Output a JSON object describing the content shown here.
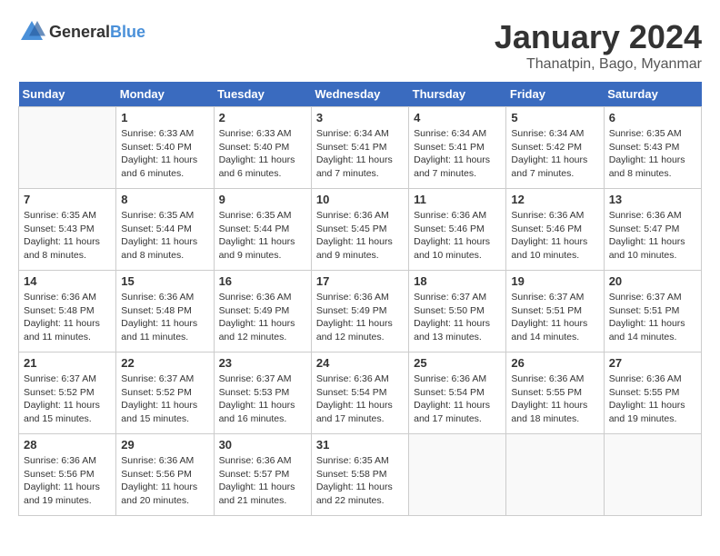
{
  "header": {
    "logo_general": "General",
    "logo_blue": "Blue",
    "month_title": "January 2024",
    "location": "Thanatpin, Bago, Myanmar"
  },
  "weekdays": [
    "Sunday",
    "Monday",
    "Tuesday",
    "Wednesday",
    "Thursday",
    "Friday",
    "Saturday"
  ],
  "weeks": [
    [
      {
        "day": "",
        "sunrise": "",
        "sunset": "",
        "daylight": ""
      },
      {
        "day": "1",
        "sunrise": "Sunrise: 6:33 AM",
        "sunset": "Sunset: 5:40 PM",
        "daylight": "Daylight: 11 hours and 6 minutes."
      },
      {
        "day": "2",
        "sunrise": "Sunrise: 6:33 AM",
        "sunset": "Sunset: 5:40 PM",
        "daylight": "Daylight: 11 hours and 6 minutes."
      },
      {
        "day": "3",
        "sunrise": "Sunrise: 6:34 AM",
        "sunset": "Sunset: 5:41 PM",
        "daylight": "Daylight: 11 hours and 7 minutes."
      },
      {
        "day": "4",
        "sunrise": "Sunrise: 6:34 AM",
        "sunset": "Sunset: 5:41 PM",
        "daylight": "Daylight: 11 hours and 7 minutes."
      },
      {
        "day": "5",
        "sunrise": "Sunrise: 6:34 AM",
        "sunset": "Sunset: 5:42 PM",
        "daylight": "Daylight: 11 hours and 7 minutes."
      },
      {
        "day": "6",
        "sunrise": "Sunrise: 6:35 AM",
        "sunset": "Sunset: 5:43 PM",
        "daylight": "Daylight: 11 hours and 8 minutes."
      }
    ],
    [
      {
        "day": "7",
        "sunrise": "Sunrise: 6:35 AM",
        "sunset": "Sunset: 5:43 PM",
        "daylight": "Daylight: 11 hours and 8 minutes."
      },
      {
        "day": "8",
        "sunrise": "Sunrise: 6:35 AM",
        "sunset": "Sunset: 5:44 PM",
        "daylight": "Daylight: 11 hours and 8 minutes."
      },
      {
        "day": "9",
        "sunrise": "Sunrise: 6:35 AM",
        "sunset": "Sunset: 5:44 PM",
        "daylight": "Daylight: 11 hours and 9 minutes."
      },
      {
        "day": "10",
        "sunrise": "Sunrise: 6:36 AM",
        "sunset": "Sunset: 5:45 PM",
        "daylight": "Daylight: 11 hours and 9 minutes."
      },
      {
        "day": "11",
        "sunrise": "Sunrise: 6:36 AM",
        "sunset": "Sunset: 5:46 PM",
        "daylight": "Daylight: 11 hours and 10 minutes."
      },
      {
        "day": "12",
        "sunrise": "Sunrise: 6:36 AM",
        "sunset": "Sunset: 5:46 PM",
        "daylight": "Daylight: 11 hours and 10 minutes."
      },
      {
        "day": "13",
        "sunrise": "Sunrise: 6:36 AM",
        "sunset": "Sunset: 5:47 PM",
        "daylight": "Daylight: 11 hours and 10 minutes."
      }
    ],
    [
      {
        "day": "14",
        "sunrise": "Sunrise: 6:36 AM",
        "sunset": "Sunset: 5:48 PM",
        "daylight": "Daylight: 11 hours and 11 minutes."
      },
      {
        "day": "15",
        "sunrise": "Sunrise: 6:36 AM",
        "sunset": "Sunset: 5:48 PM",
        "daylight": "Daylight: 11 hours and 11 minutes."
      },
      {
        "day": "16",
        "sunrise": "Sunrise: 6:36 AM",
        "sunset": "Sunset: 5:49 PM",
        "daylight": "Daylight: 11 hours and 12 minutes."
      },
      {
        "day": "17",
        "sunrise": "Sunrise: 6:36 AM",
        "sunset": "Sunset: 5:49 PM",
        "daylight": "Daylight: 11 hours and 12 minutes."
      },
      {
        "day": "18",
        "sunrise": "Sunrise: 6:37 AM",
        "sunset": "Sunset: 5:50 PM",
        "daylight": "Daylight: 11 hours and 13 minutes."
      },
      {
        "day": "19",
        "sunrise": "Sunrise: 6:37 AM",
        "sunset": "Sunset: 5:51 PM",
        "daylight": "Daylight: 11 hours and 14 minutes."
      },
      {
        "day": "20",
        "sunrise": "Sunrise: 6:37 AM",
        "sunset": "Sunset: 5:51 PM",
        "daylight": "Daylight: 11 hours and 14 minutes."
      }
    ],
    [
      {
        "day": "21",
        "sunrise": "Sunrise: 6:37 AM",
        "sunset": "Sunset: 5:52 PM",
        "daylight": "Daylight: 11 hours and 15 minutes."
      },
      {
        "day": "22",
        "sunrise": "Sunrise: 6:37 AM",
        "sunset": "Sunset: 5:52 PM",
        "daylight": "Daylight: 11 hours and 15 minutes."
      },
      {
        "day": "23",
        "sunrise": "Sunrise: 6:37 AM",
        "sunset": "Sunset: 5:53 PM",
        "daylight": "Daylight: 11 hours and 16 minutes."
      },
      {
        "day": "24",
        "sunrise": "Sunrise: 6:36 AM",
        "sunset": "Sunset: 5:54 PM",
        "daylight": "Daylight: 11 hours and 17 minutes."
      },
      {
        "day": "25",
        "sunrise": "Sunrise: 6:36 AM",
        "sunset": "Sunset: 5:54 PM",
        "daylight": "Daylight: 11 hours and 17 minutes."
      },
      {
        "day": "26",
        "sunrise": "Sunrise: 6:36 AM",
        "sunset": "Sunset: 5:55 PM",
        "daylight": "Daylight: 11 hours and 18 minutes."
      },
      {
        "day": "27",
        "sunrise": "Sunrise: 6:36 AM",
        "sunset": "Sunset: 5:55 PM",
        "daylight": "Daylight: 11 hours and 19 minutes."
      }
    ],
    [
      {
        "day": "28",
        "sunrise": "Sunrise: 6:36 AM",
        "sunset": "Sunset: 5:56 PM",
        "daylight": "Daylight: 11 hours and 19 minutes."
      },
      {
        "day": "29",
        "sunrise": "Sunrise: 6:36 AM",
        "sunset": "Sunset: 5:56 PM",
        "daylight": "Daylight: 11 hours and 20 minutes."
      },
      {
        "day": "30",
        "sunrise": "Sunrise: 6:36 AM",
        "sunset": "Sunset: 5:57 PM",
        "daylight": "Daylight: 11 hours and 21 minutes."
      },
      {
        "day": "31",
        "sunrise": "Sunrise: 6:35 AM",
        "sunset": "Sunset: 5:58 PM",
        "daylight": "Daylight: 11 hours and 22 minutes."
      },
      {
        "day": "",
        "sunrise": "",
        "sunset": "",
        "daylight": ""
      },
      {
        "day": "",
        "sunrise": "",
        "sunset": "",
        "daylight": ""
      },
      {
        "day": "",
        "sunrise": "",
        "sunset": "",
        "daylight": ""
      }
    ]
  ]
}
